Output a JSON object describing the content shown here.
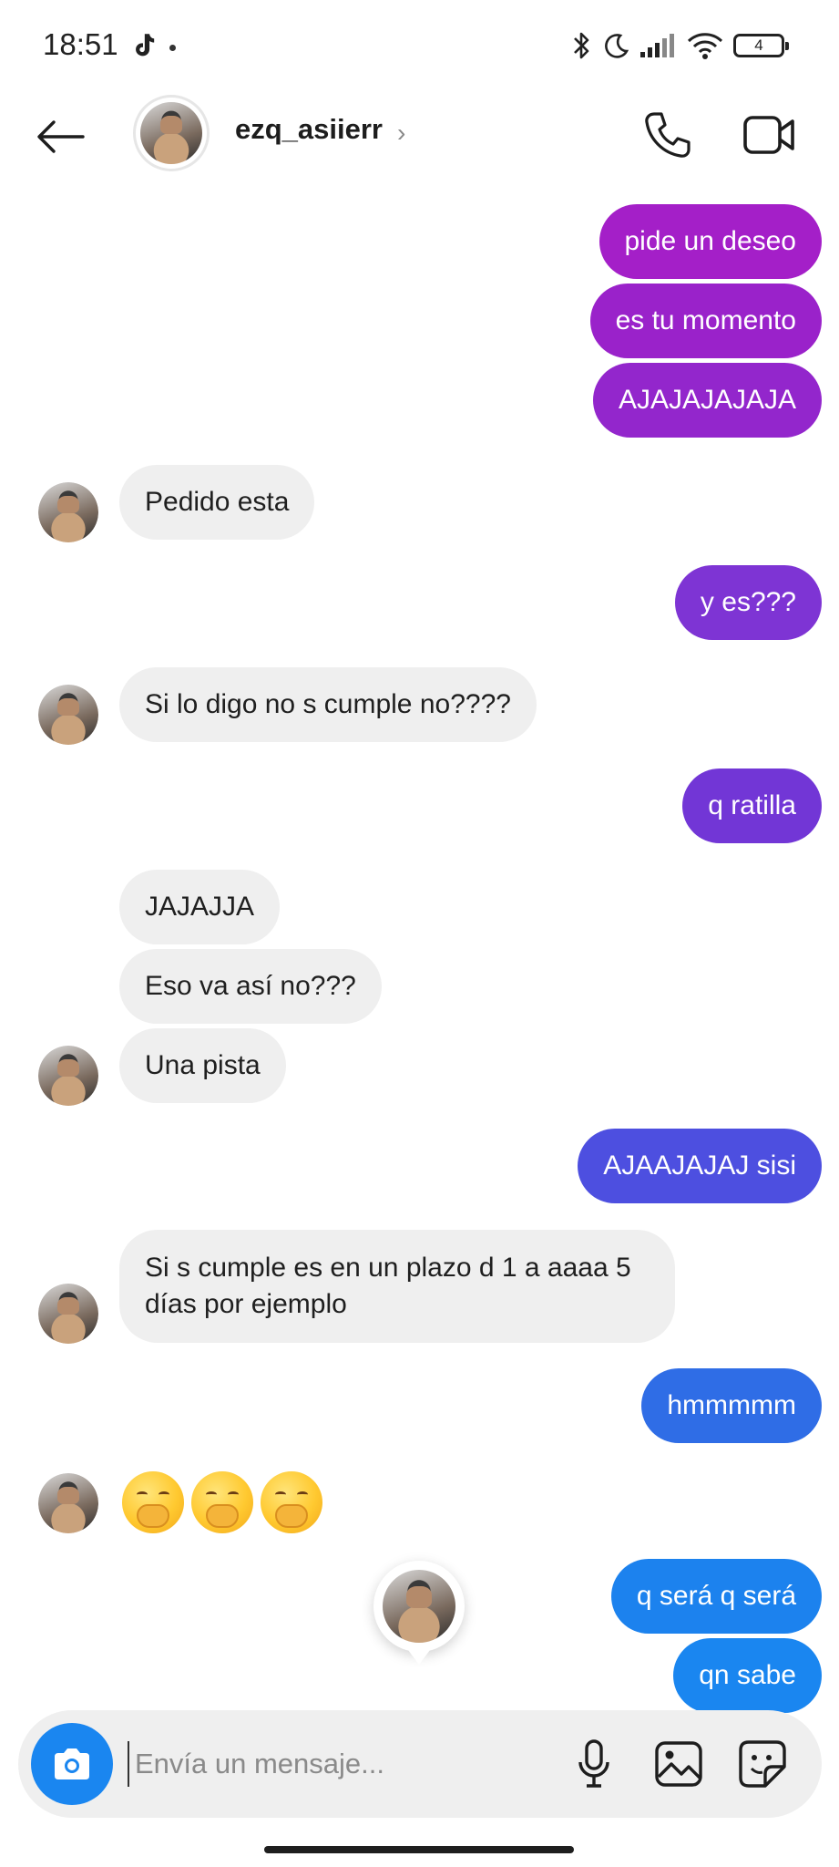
{
  "status_bar": {
    "time": "18:51",
    "battery": "4"
  },
  "header": {
    "username": "ezq_asiierr",
    "chevron": "›"
  },
  "messages": {
    "s1": "pide un deseo",
    "s2": "es tu momento",
    "s3": "AJAJAJAJAJA",
    "r1": "Pedido esta",
    "s4": "y es???",
    "r2": "Si lo digo no s cumple no????",
    "s5": "q ratilla",
    "r3": "JAJAJJA",
    "r4": "Eso va así no???",
    "r5": "Una pista",
    "s6": "AJAAJAJAJ sisi",
    "r6": "Si s cumple es en un plazo d 1 a aaaa 5 días por ejemplo",
    "s7": "hmmmmm",
    "r7_emoji": "🤭🤭🤭",
    "s8": "q será q será",
    "s9": "qn sabe"
  },
  "composer": {
    "placeholder": "Envía un mensaje..."
  },
  "colors": {
    "bubble_purple": "#a020c8",
    "bubble_violet": "#7b35d6",
    "bubble_indigo": "#5a46e0",
    "bubble_blue": "#2f6fe8",
    "bubble_azure": "#1a86f0",
    "received_bg": "#efefef",
    "camera_button": "#1a86f0"
  },
  "icons": [
    "back-arrow-icon",
    "phone-icon",
    "video-icon",
    "camera-icon",
    "microphone-icon",
    "gallery-icon",
    "sticker-icon",
    "tiktok-icon",
    "bluetooth-icon",
    "moon-icon",
    "signal-icon",
    "wifi-icon",
    "battery-icon"
  ]
}
